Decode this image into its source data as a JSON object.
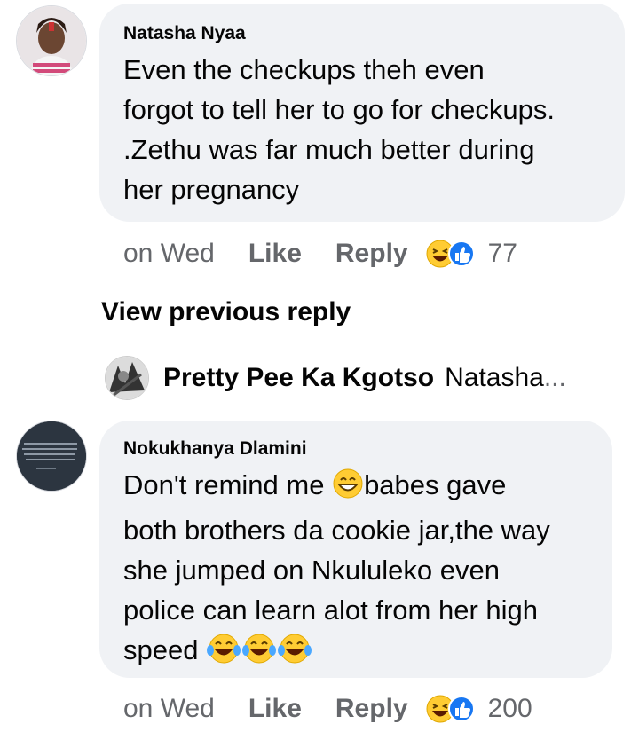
{
  "comments": [
    {
      "author": "Natasha Nyaa",
      "lines": [
        " Even the checkups theh even",
        "forgot to tell her to go for checkups.",
        ".Zethu was far much better during",
        "her pregnancy"
      ],
      "time": "on Wed",
      "like_label": "Like",
      "reply_label": "Reply",
      "reaction_count": "77",
      "reaction_icons": [
        "laughing-emoji",
        "like-thumb"
      ]
    },
    {
      "author": "Nokukhanya Dlamini",
      "line1_before": "Don't remind me ",
      "line1_emoji": "grinning-emoji",
      "line1_after": "babes gave",
      "lines_rest": [
        "both brothers da cookie jar,the way",
        "she jumped on Nkululeko even",
        "police can learn alot from her high"
      ],
      "last_line_text": "speed ",
      "last_line_emojis": [
        "tears-of-joy-emoji",
        "tears-of-joy-emoji",
        "tears-of-joy-emoji"
      ],
      "time": "on Wed",
      "like_label": "Like",
      "reply_label": "Reply",
      "reaction_count": "200",
      "reaction_icons": [
        "laughing-emoji",
        "like-thumb"
      ]
    }
  ],
  "view_previous_reply": "View previous reply",
  "reply_preview": {
    "author": "Pretty Pee Ka Kgotso",
    "text": "Natasha",
    "ellipsis": "..."
  },
  "colors": {
    "bubble": "#f0f2f5",
    "meta_text": "#65676b",
    "like_blue": "#1877f2",
    "emoji_yellow": "#ffcc33"
  }
}
